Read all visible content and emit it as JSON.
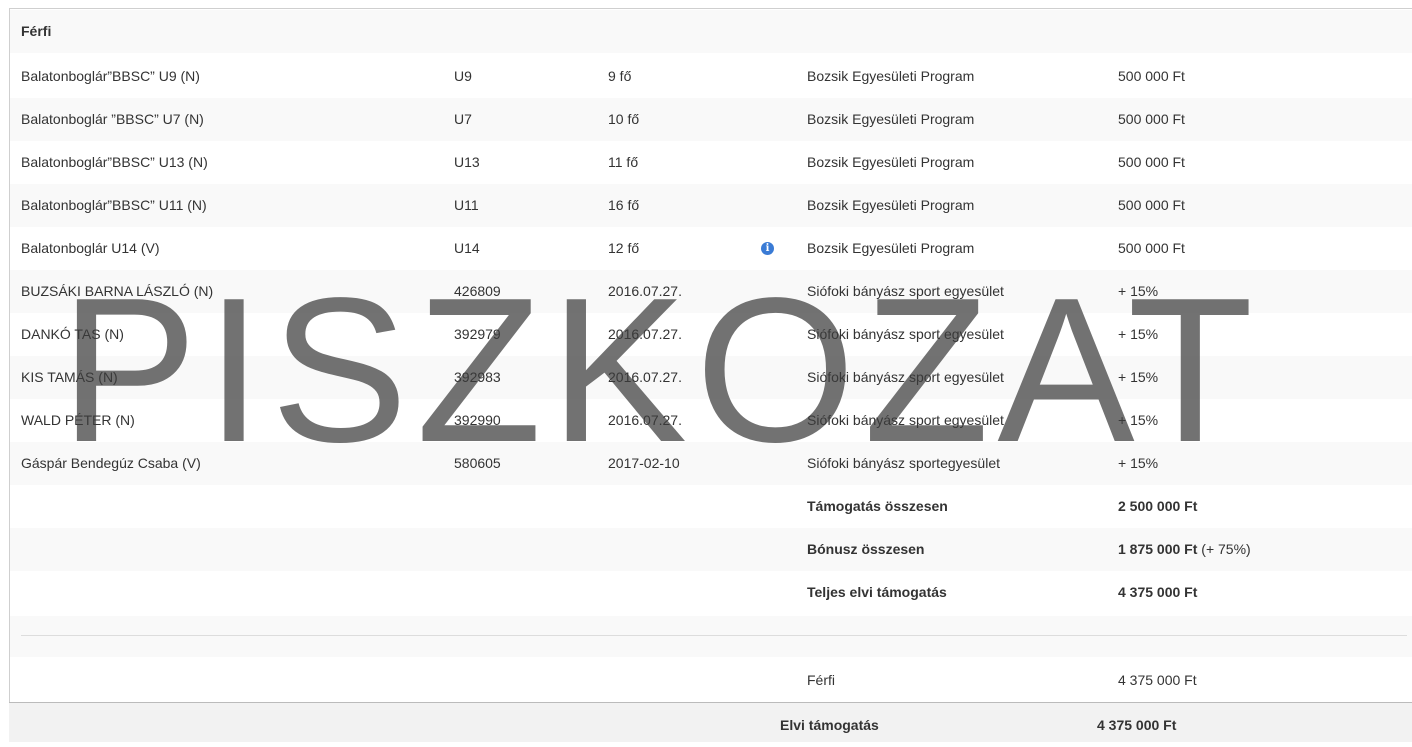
{
  "section_title": "Férfi",
  "rows": [
    {
      "name": "Balatonboglár”BBSC” U9 (N)",
      "code": "U9",
      "count": "9 fő",
      "info": false,
      "program": "Bozsik Egyesületi Program",
      "amount": "500 000 Ft"
    },
    {
      "name": "Balatonboglár ”BBSC” U7 (N)",
      "code": "U7",
      "count": "10 fő",
      "info": false,
      "program": "Bozsik Egyesületi Program",
      "amount": "500 000 Ft"
    },
    {
      "name": "Balatonboglár”BBSC” U13 (N)",
      "code": "U13",
      "count": "11 fő",
      "info": false,
      "program": "Bozsik Egyesületi Program",
      "amount": "500 000 Ft"
    },
    {
      "name": "Balatonboglár”BBSC” U11 (N)",
      "code": "U11",
      "count": "16 fő",
      "info": false,
      "program": "Bozsik Egyesületi Program",
      "amount": "500 000 Ft"
    },
    {
      "name": "Balatonboglár U14 (V)",
      "code": "U14",
      "count": "12 fő",
      "info": true,
      "program": "Bozsik Egyesületi Program",
      "amount": "500 000 Ft"
    },
    {
      "name": "BUZSÁKI BARNA LÁSZLÓ (N)",
      "code": "426809",
      "count": "2016.07.27.",
      "info": false,
      "program": "Siófoki bányász sport egyesület",
      "amount": "+ 15%"
    },
    {
      "name": "DANKÓ TAS (N)",
      "code": "392979",
      "count": "2016.07.27.",
      "info": false,
      "program": "Siófoki bányász sport egyesület",
      "amount": "+ 15%"
    },
    {
      "name": "KIS TAMÁS (N)",
      "code": "392983",
      "count": "2016.07.27.",
      "info": false,
      "program": "Siófoki bányász sport egyesület",
      "amount": "+ 15%"
    },
    {
      "name": "WALD PÉTER (N)",
      "code": "392990",
      "count": "2016.07.27.",
      "info": false,
      "program": "Siófoki bányász sport egyesület",
      "amount": "+ 15%"
    },
    {
      "name": "Gáspár Bendegúz Csaba (V)",
      "code": "580605",
      "count": "2017-02-10",
      "info": false,
      "program": "Siófoki bányász sportegyesület",
      "amount": "+ 15%"
    }
  ],
  "totals": {
    "support_label": "Támogatás összesen",
    "support_value": "2 500 000 Ft",
    "bonus_label": "Bónusz összesen",
    "bonus_value": "1 875 000 Ft",
    "bonus_percent": "(+ 75%)",
    "full_label": "Teljes elvi támogatás",
    "full_value": "4 375 000 Ft"
  },
  "summary": {
    "category_label": "Férfi",
    "category_value": "4 375 000 Ft"
  },
  "footer": {
    "label": "Elvi támogatás",
    "value": "4 375 000 Ft"
  },
  "watermark": "PISZKOZAT",
  "colors": {
    "info_icon": "#3a7bd5"
  }
}
